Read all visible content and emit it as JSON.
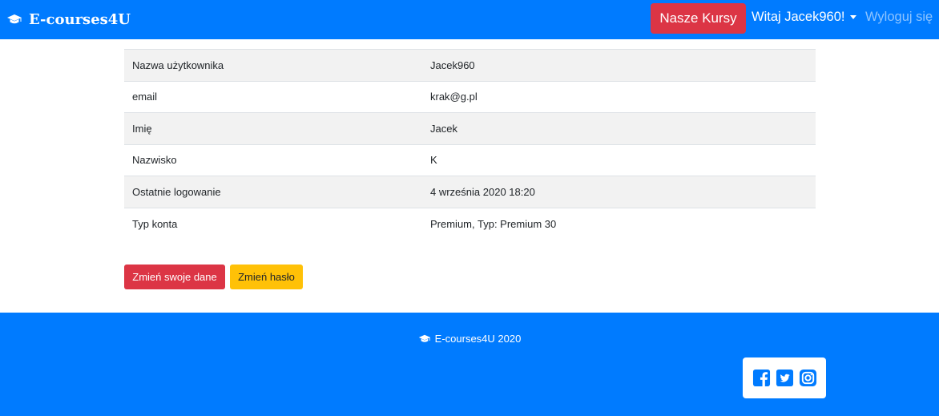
{
  "navbar": {
    "brand": "E-courses4U",
    "courses_button": "Nasze Kursy",
    "user_greeting": "Witaj Jacek960!",
    "logout": "Wyloguj się"
  },
  "profile": {
    "rows": [
      {
        "label": "Nazwa użytkownika",
        "value": "Jacek960"
      },
      {
        "label": "email",
        "value": "krak@g.pl"
      },
      {
        "label": "Imię",
        "value": "Jacek"
      },
      {
        "label": "Nazwisko",
        "value": "K"
      },
      {
        "label": "Ostatnie logowanie",
        "value": "4 września 2020 18:20"
      },
      {
        "label": "Typ konta",
        "value": "Premium, Typ: Premium 30"
      }
    ]
  },
  "actions": {
    "edit_data": "Zmień swoje dane",
    "change_password": "Zmień hasło"
  },
  "footer": {
    "copyright": "E-courses4U 2020",
    "social_icons": [
      "facebook-icon",
      "twitter-icon",
      "instagram-icon"
    ]
  },
  "colors": {
    "primary": "#007bff",
    "danger": "#dc3545",
    "warning": "#ffc107",
    "stripe": "#f2f2f2"
  }
}
